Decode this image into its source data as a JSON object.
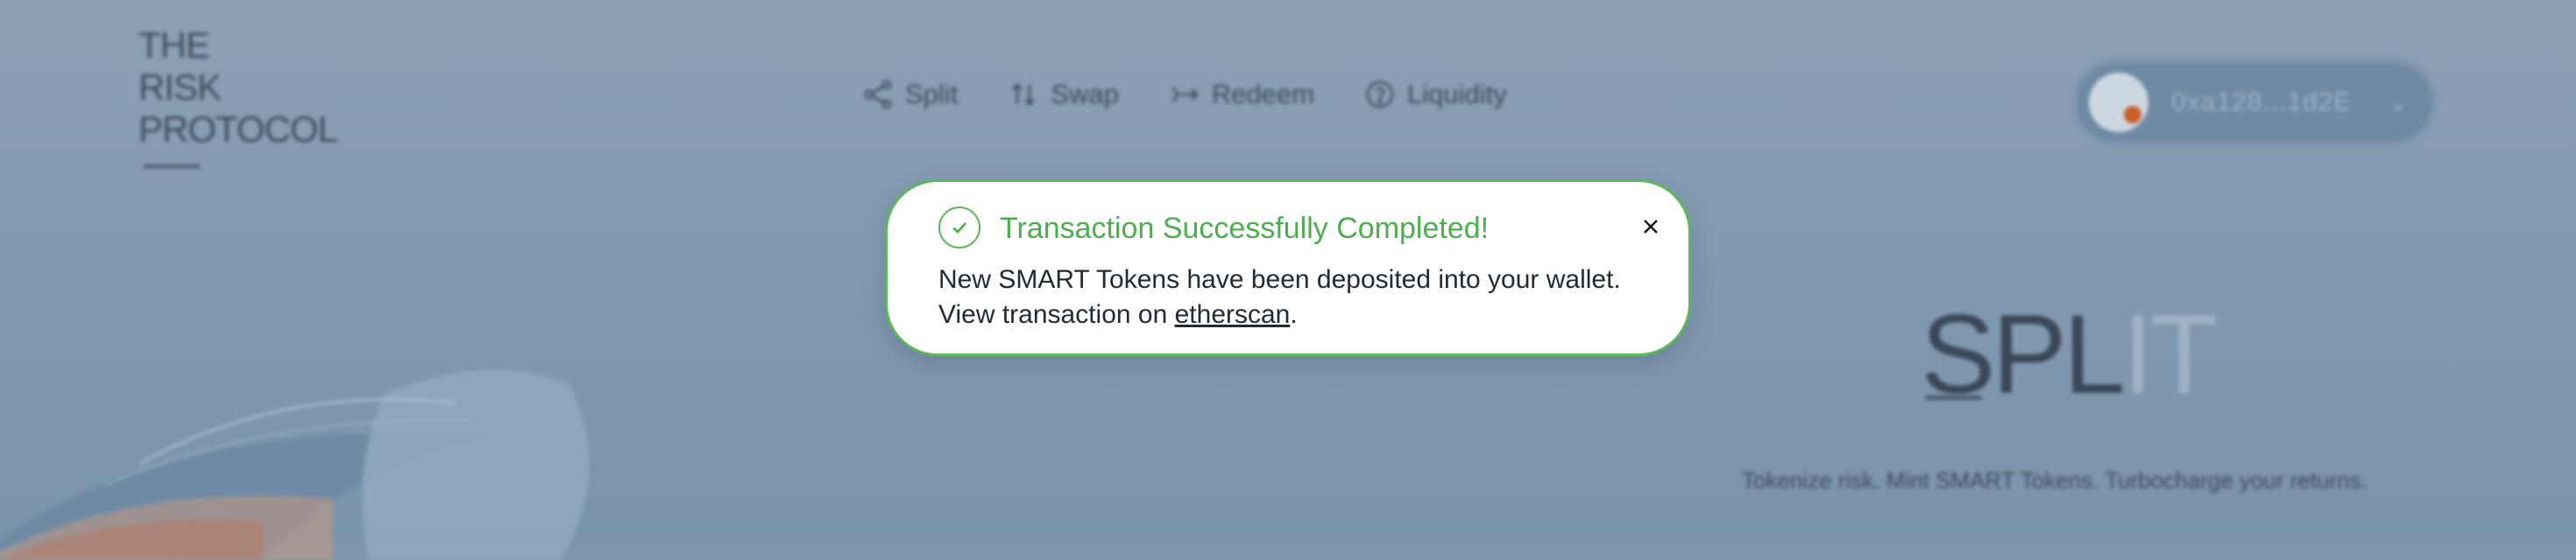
{
  "logo": {
    "lines": [
      "THE",
      "RISK",
      "PROTOCOL"
    ]
  },
  "nav": {
    "items": [
      {
        "label": "Split",
        "icon": "split-icon"
      },
      {
        "label": "Swap",
        "icon": "swap-icon"
      },
      {
        "label": "Redeem",
        "icon": "redeem-icon"
      },
      {
        "label": "Liquidity",
        "icon": "liquidity-icon"
      }
    ]
  },
  "wallet": {
    "address": "0xa128...1d2E",
    "icon": "chevron-down-icon"
  },
  "hero": {
    "title_main": "SPL",
    "title_faded": "IT",
    "subtitle": "Tokenize risk. Mint SMART Tokens. Turbocharge your returns."
  },
  "toast": {
    "title": "Transaction Successfully Completed!",
    "body_before": "New SMART Tokens have been deposited into your wallet. View transaction on ",
    "link_text": "etherscan",
    "body_after": ".",
    "close_icon": "close-icon",
    "status_icon": "check-circle-icon"
  },
  "colors": {
    "success": "#5cb85c",
    "overlay_bg": "#8199b0",
    "text_dark": "#222a33"
  }
}
